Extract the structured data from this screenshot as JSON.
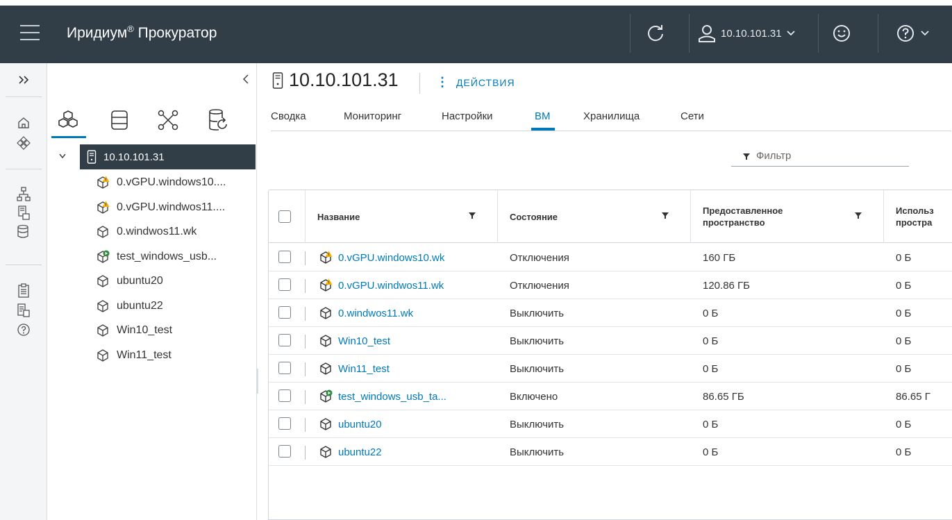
{
  "header": {
    "app_title": "Иридиум",
    "app_title_sup": "®",
    "app_title_suffix": " Прокуратор",
    "user": "10.10.101.31"
  },
  "nav": {
    "root": {
      "label": "10.10.101.31",
      "icon": "server-icon"
    },
    "items": [
      {
        "label": "0.vGPU.windows10....",
        "status": "warning"
      },
      {
        "label": "0.vGPU.windwos11....",
        "status": "warning"
      },
      {
        "label": "0.windwos11.wk",
        "status": "off"
      },
      {
        "label": "test_windows_usb...",
        "status": "on"
      },
      {
        "label": "ubuntu20",
        "status": "off"
      },
      {
        "label": "ubuntu22",
        "status": "off"
      },
      {
        "label": "Win10_test",
        "status": "off"
      },
      {
        "label": "Win11_test",
        "status": "off"
      }
    ]
  },
  "main": {
    "title": "10.10.101.31",
    "actions": "ДЕЙСТВИЯ",
    "tabs": [
      "Сводка",
      "Мониторинг",
      "Настройки",
      "ВМ",
      "Хранилища",
      "Сети"
    ],
    "active_tab": "ВМ",
    "filter_placeholder": "Фильтр"
  },
  "table": {
    "columns": {
      "name": "Название",
      "state": "Состояние",
      "provisioned_line1": "Предоставленное",
      "provisioned_line2": "пространство",
      "used_line1": "Использ",
      "used_line2": "простра"
    },
    "rows": [
      {
        "name": "0.vGPU.windows10.wk",
        "status": "warning",
        "state": "Отключения",
        "provisioned": "160 ГБ",
        "used": "0 Б"
      },
      {
        "name": "0.vGPU.windwos11.wk",
        "status": "warning",
        "state": "Отключения",
        "provisioned": "120.86 ГБ",
        "used": "0 Б"
      },
      {
        "name": "0.windwos11.wk",
        "status": "off",
        "state": "Выключить",
        "provisioned": "0 Б",
        "used": "0 Б"
      },
      {
        "name": "Win10_test",
        "status": "off",
        "state": "Выключить",
        "provisioned": "0 Б",
        "used": "0 Б"
      },
      {
        "name": "Win11_test",
        "status": "off",
        "state": "Выключить",
        "provisioned": "0 Б",
        "used": "0 Б"
      },
      {
        "name": "test_windows_usb_ta...",
        "status": "on",
        "state": "Включено",
        "provisioned": "86.65 ГБ",
        "used": "86.65 Г"
      },
      {
        "name": "ubuntu20",
        "status": "off",
        "state": "Выключить",
        "provisioned": "0 Б",
        "used": "0 Б"
      },
      {
        "name": "ubuntu22",
        "status": "off",
        "state": "Выключить",
        "provisioned": "0 Б",
        "used": "0 Б"
      }
    ]
  },
  "colors": {
    "header_bg": "#313d47",
    "accent": "#0079b8",
    "warning": "#f5b300",
    "power_on": "#2e8b3d"
  }
}
